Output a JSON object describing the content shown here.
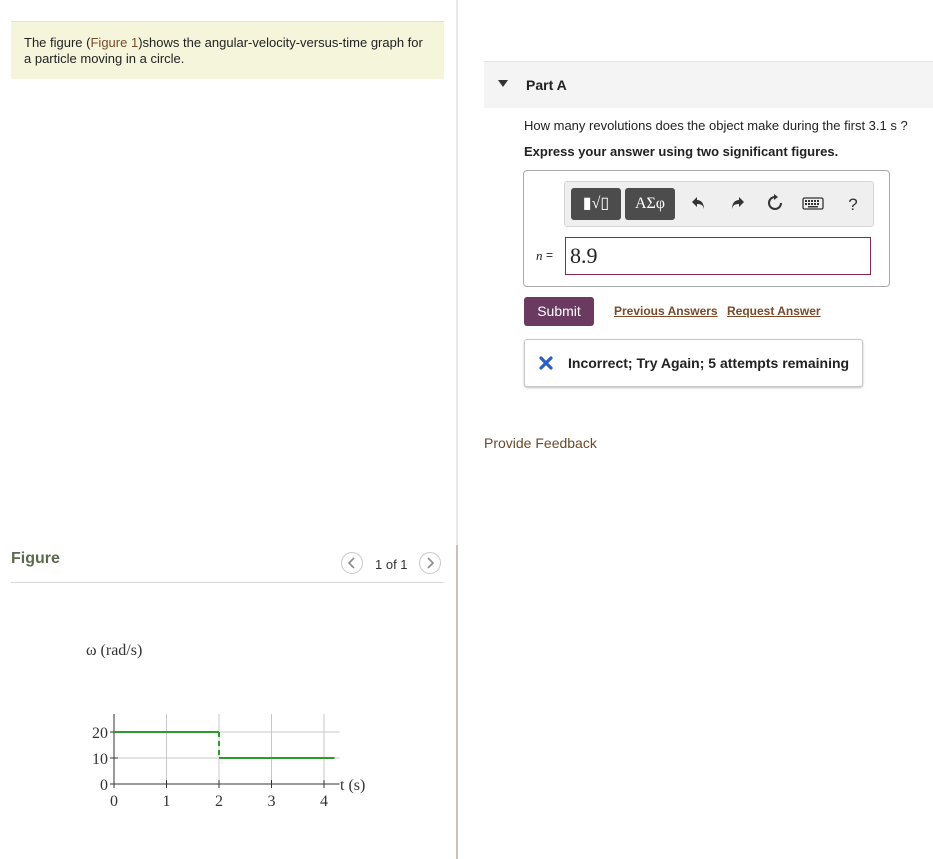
{
  "intro": {
    "prefix": "The figure (",
    "link": "Figure 1",
    "suffix": ")shows the angular-velocity-versus-time graph for a particle moving in a circle."
  },
  "figure": {
    "heading": "Figure",
    "pager": "1 of 1",
    "prev_icon": "chevron-left-icon",
    "next_icon": "chevron-right-icon"
  },
  "part": {
    "title": "Part A",
    "question": "How many revolutions does the object make during the first 3.1 s ?",
    "instruction": "Express your answer using two significant figures."
  },
  "toolbar": {
    "template_btn": "▮√▯",
    "symbols_btn": "ΑΣφ",
    "icons": [
      "undo-icon",
      "redo-icon",
      "reset-icon",
      "keyboard-icon",
      "help-icon"
    ],
    "help_label": "?"
  },
  "answer": {
    "variable": "n",
    "equals": "=",
    "value": "8.9"
  },
  "actions": {
    "submit": "Submit",
    "previous_answers": "Previous Answers",
    "request_answer": "Request Answer"
  },
  "feedback": {
    "icon": "x-mark-icon",
    "message": "Incorrect; Try Again; 5 attempts remaining",
    "color": "#2a5fc4"
  },
  "provide_feedback": "Provide Feedback",
  "colors": {
    "intro_bg": "#f5f5dc",
    "submit_bg": "#6a3a60",
    "plot_line": "#2e9a2e"
  },
  "chart_data": {
    "type": "line",
    "ylabel": "ω (rad/s)",
    "xlabel": "t (s)",
    "x_ticks": [
      0,
      1,
      2,
      3,
      4
    ],
    "y_ticks": [
      0,
      10,
      20
    ],
    "xlim": [
      0,
      4.2
    ],
    "ylim": [
      0,
      20
    ],
    "grid": true,
    "series": [
      {
        "x": [
          0,
          2,
          2,
          4.2
        ],
        "y": [
          20,
          20,
          10,
          10
        ]
      }
    ]
  }
}
